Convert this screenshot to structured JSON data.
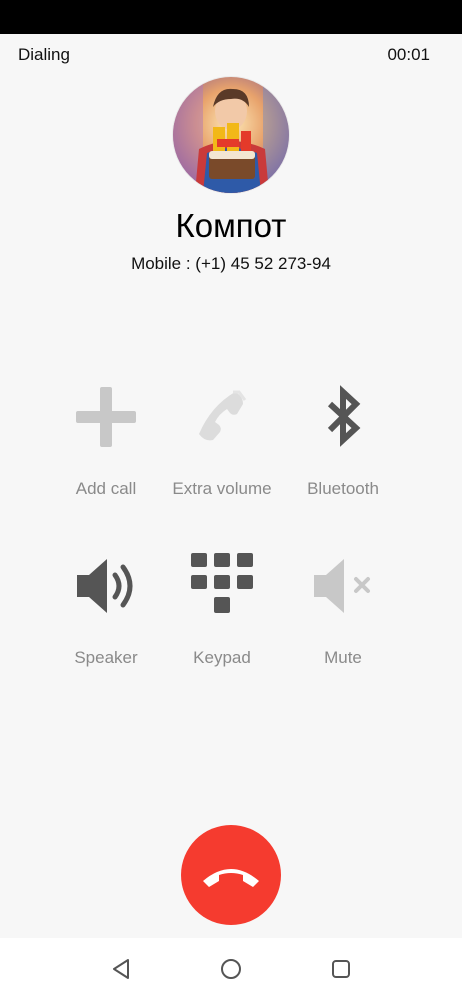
{
  "header": {
    "state": "Dialing",
    "timer": "00:01"
  },
  "contact": {
    "name": "Компот",
    "number": "Mobile : (+1) 45 52 273-94"
  },
  "actions": [
    {
      "label": "Add call",
      "icon": "plus-icon",
      "enabled": false
    },
    {
      "label": "Extra volume",
      "icon": "phone-volume-icon",
      "enabled": false
    },
    {
      "label": "Bluetooth",
      "icon": "bluetooth-icon",
      "enabled": true
    },
    {
      "label": "Speaker",
      "icon": "speaker-icon",
      "enabled": true
    },
    {
      "label": "Keypad",
      "icon": "keypad-icon",
      "enabled": true
    },
    {
      "label": "Mute",
      "icon": "mute-icon",
      "enabled": false
    }
  ],
  "colors": {
    "end_call": "#f53b2f",
    "icon_active": "#555555",
    "icon_disabled": "#c8c8c8",
    "label": "#8a8a8a"
  },
  "nav": {
    "back": "back-icon",
    "home": "home-icon",
    "recents": "recents-icon"
  }
}
